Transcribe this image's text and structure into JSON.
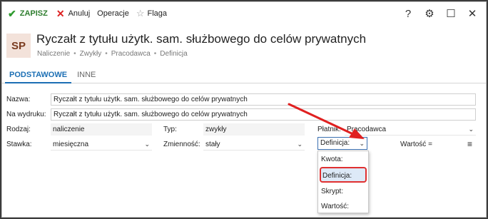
{
  "toolbar": {
    "save_label": "ZAPISZ",
    "cancel_label": "Anuluj",
    "operations_label": "Operacje",
    "flag_label": "Flaga"
  },
  "window_controls": {
    "help": "?",
    "settings": "⚙",
    "maximize": "☐",
    "close": "✕"
  },
  "header": {
    "badge": "SP",
    "title": "Ryczałt z tytułu użytk. sam. służbowego do celów prywatnych",
    "breadcrumb": [
      "Naliczenie",
      "Zwykły",
      "Pracodawca",
      "Definicja"
    ]
  },
  "tabs": [
    {
      "label": "PODSTAWOWE",
      "active": true
    },
    {
      "label": "INNE",
      "active": false
    }
  ],
  "form": {
    "nazwa_label": "Nazwa:",
    "nazwa_value": "Ryczałt z tytułu użytk. sam. służbowego do celów prywatnych",
    "wydruk_label": "Na wydruku:",
    "wydruk_value": "Ryczałt z tytułu użytk. sam. służbowego do celów prywatnych",
    "rodzaj_label": "Rodzaj:",
    "rodzaj_value": "naliczenie",
    "typ_label": "Typ:",
    "typ_value": "zwykły",
    "platnik_label": "Płatnik:",
    "platnik_value": "Pracodawca",
    "stawka_label": "Stawka:",
    "stawka_value": "miesięczna",
    "zmiennosc_label": "Zmienność:",
    "zmiennosc_value": "stały",
    "definicja_select": "Definicja:",
    "wartosc_label": "Wartość ="
  },
  "dropdown": {
    "options": [
      "Kwota:",
      "Definicja:",
      "Skrypt:",
      "Wartość:"
    ],
    "selected": "Definicja:"
  },
  "colors": {
    "accent": "#1c6fb4",
    "highlight_border": "#e03030",
    "save_green": "#2e7d2e"
  }
}
